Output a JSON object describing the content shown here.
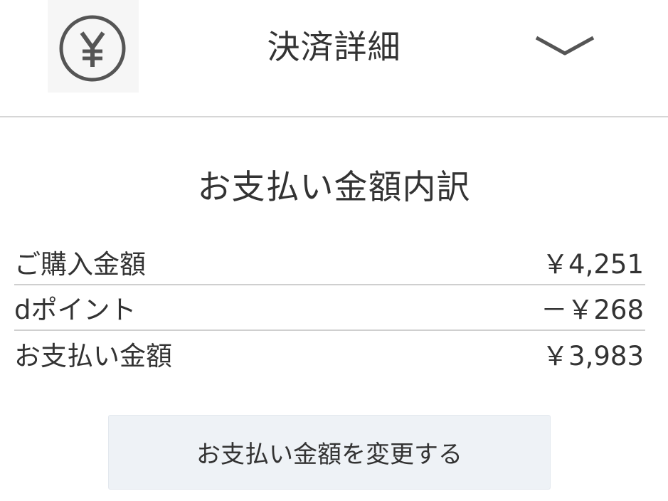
{
  "header": {
    "title": "決済詳細",
    "icon": "yen-circle-icon",
    "toggle_icon": "chevron-down-icon"
  },
  "breakdown": {
    "title": "お支払い金額内訳",
    "rows": [
      {
        "label": "ご購入金額",
        "amount": "￥4,251"
      },
      {
        "label": "dポイント",
        "amount": "－￥268"
      },
      {
        "label": "お支払い金額",
        "amount": "￥3,983"
      }
    ]
  },
  "actions": {
    "change_button_label": "お支払い金額を変更する"
  },
  "colors": {
    "text": "#333333",
    "divider": "#cfcfcf",
    "button_bg": "#eef2f6"
  }
}
